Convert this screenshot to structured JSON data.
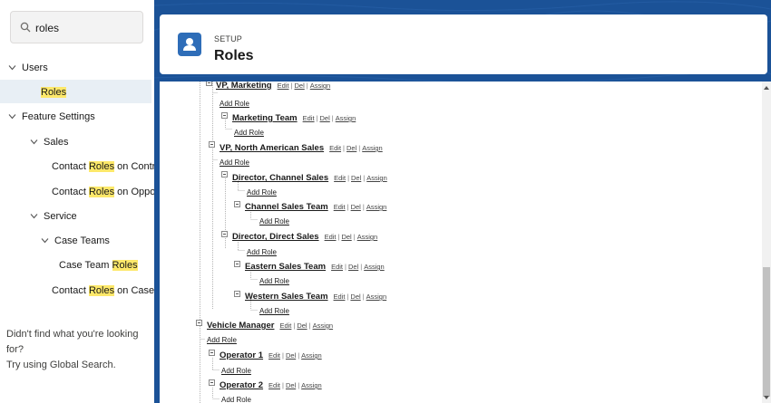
{
  "search": {
    "value": "roles"
  },
  "nav": {
    "users": "Users",
    "roles": "Roles",
    "feature_settings": "Feature Settings",
    "sales": "Sales",
    "contact_roles_on_contracts": {
      "pre": "Contact ",
      "hl": "Roles",
      "post": " on Contracts"
    },
    "contact_roles_on_opportunities": {
      "pre": "Contact ",
      "hl": "Roles",
      "post": " on Opportunities"
    },
    "service": "Service",
    "case_teams": "Case Teams",
    "case_team_roles": {
      "pre": "Case Team ",
      "hl": "Roles",
      "post": ""
    },
    "contact_roles_on_cases": {
      "pre": "Contact ",
      "hl": "Roles",
      "post": " on Cases"
    }
  },
  "sidebar_note": {
    "line1": "Didn't find what you're looking for?",
    "line2": "Try using Global Search."
  },
  "header": {
    "setup": "SETUP",
    "title": "Roles"
  },
  "actions": {
    "edit": "Edit",
    "del": "Del",
    "assign": "Assign",
    "separator": "|",
    "add_role": "Add Role"
  },
  "roles": [
    {
      "name": "VP, Marketing"
    },
    {
      "name": "Marketing Team"
    },
    {
      "name": "VP, North American Sales"
    },
    {
      "name": "Director, Channel Sales"
    },
    {
      "name": "Channel Sales Team"
    },
    {
      "name": "Director, Direct Sales"
    },
    {
      "name": "Eastern Sales Team"
    },
    {
      "name": "Western Sales Team"
    },
    {
      "name": "Vehicle Manager"
    },
    {
      "name": "Operator 1"
    },
    {
      "name": "Operator 2"
    }
  ],
  "colors": {
    "brand_blue": "#1b5297",
    "highlight": "#fde86a",
    "selected_bg": "#e8eff5",
    "icon_blue": "#2e6db8"
  }
}
